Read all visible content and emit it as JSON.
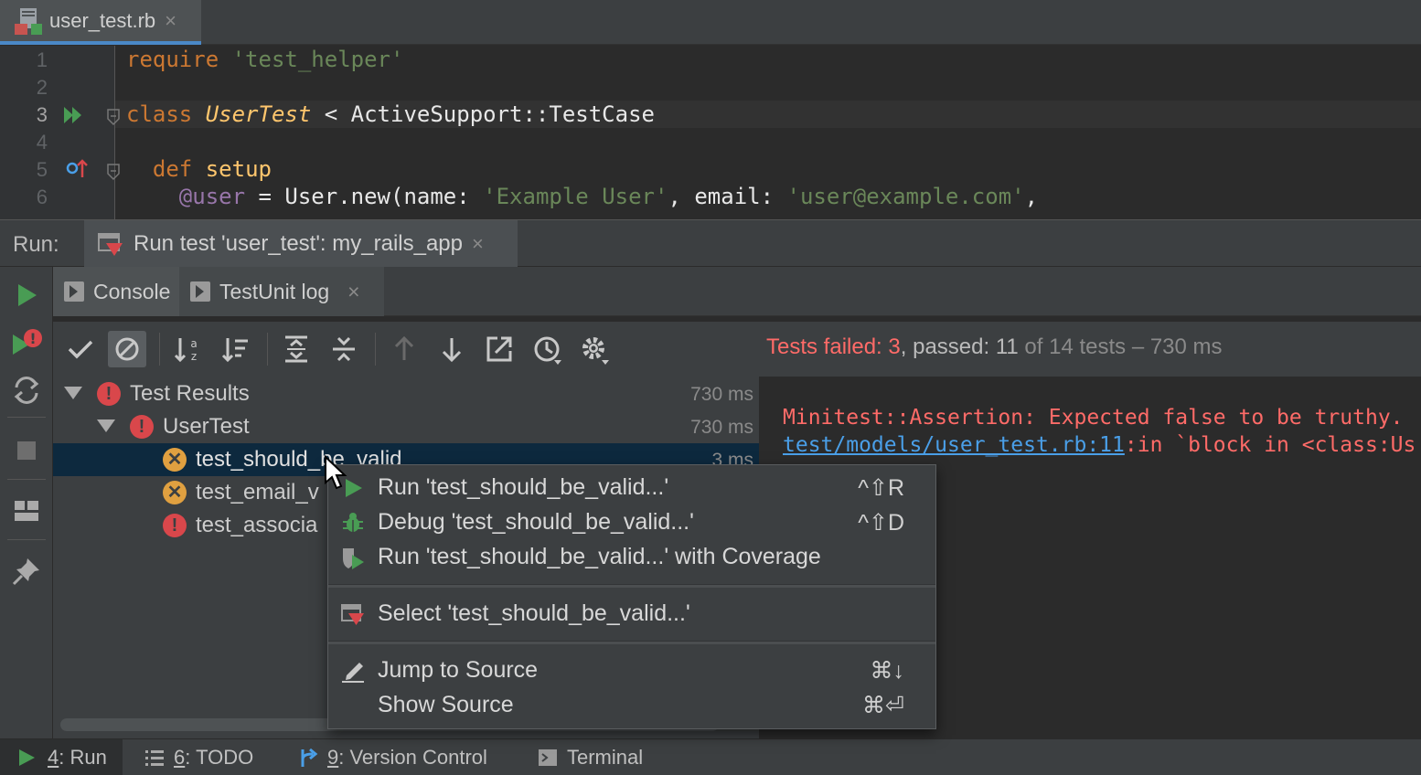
{
  "editor_tab": {
    "title": "user_test.rb",
    "close": "×"
  },
  "editor": {
    "line_numbers": [
      "1",
      "2",
      "3",
      "4",
      "5",
      "6"
    ],
    "lines": {
      "l1_kw": "require",
      "l1_str": "'test_helper'",
      "l3_kw": "class",
      "l3_cls": "UserTest",
      "l3_rest": " < ActiveSupport::TestCase",
      "l5_kw": "def",
      "l5_fn": "setup",
      "l6_ivar": "@user",
      "l6_eq": " = ",
      "l6_user": "User",
      "l6_rest": ".new(name: ",
      "l6_str1": "'Example User'",
      "l6_mid": ", email: ",
      "l6_str2": "'user@example.com'",
      "l6_end": ","
    }
  },
  "run_panel": {
    "label": "Run:",
    "tab_title": "Run test 'user_test': my_rails_app",
    "tab_close": "×"
  },
  "sub_tabs": {
    "console": "Console",
    "testunit_log": "TestUnit log",
    "close": "×"
  },
  "status": {
    "failed_label": "Tests failed: ",
    "failed_count": "3",
    "passed_label": ", passed: ",
    "passed_count": "11",
    "of_label": " of 14 tests – 730 ms"
  },
  "tree": {
    "root": {
      "label": "Test Results",
      "time": "730 ms"
    },
    "suite": {
      "label": "UserTest",
      "time": "730 ms"
    },
    "tests": [
      {
        "label": "test_should_be_valid",
        "time": "3 ms",
        "status": "fail"
      },
      {
        "label": "test_email_v",
        "status": "fail"
      },
      {
        "label": "test_associa",
        "status": "error"
      }
    ]
  },
  "console": {
    "line1": "Minitest::Assertion: Expected false to be truthy.",
    "link": "test/models/user_test.rb:11",
    "line2_rest": ":in `block in <class:Us"
  },
  "context_menu": {
    "items": [
      {
        "label": "Run 'test_should_be_valid...'",
        "shortcut": "^⇧R",
        "icon": "run-icon"
      },
      {
        "label": "Debug 'test_should_be_valid...'",
        "shortcut": "^⇧D",
        "icon": "debug-icon"
      },
      {
        "label": "Run 'test_should_be_valid...' with Coverage",
        "shortcut": "",
        "icon": "coverage-icon"
      },
      {
        "label": "Select 'test_should_be_valid...'",
        "shortcut": "",
        "icon": "select-icon"
      },
      {
        "label": "Jump to Source",
        "shortcut": "⌘↓",
        "icon": "edit-icon"
      },
      {
        "label": "Show Source",
        "shortcut": "⌘⏎",
        "icon": ""
      }
    ]
  },
  "bottom_bar": {
    "run": {
      "num": "4",
      "label": ": Run"
    },
    "todo": {
      "num": "6",
      "label": ": TODO"
    },
    "vcs": {
      "num": "9",
      "label": ": Version Control"
    },
    "terminal": {
      "label": "Terminal"
    }
  },
  "colors": {
    "accent_green": "#499c54",
    "error_red": "#d9474b",
    "fail_orange": "#e0a040",
    "link_blue": "#4a9fe8"
  }
}
